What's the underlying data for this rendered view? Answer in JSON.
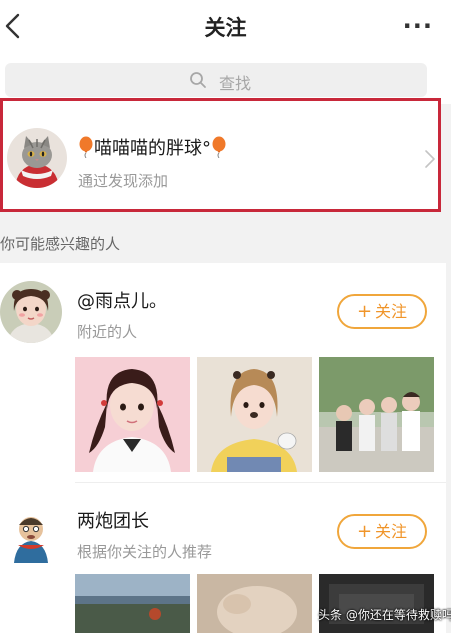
{
  "header": {
    "title": "关注",
    "more_label": "···"
  },
  "search": {
    "placeholder": "查找"
  },
  "highlighted_user": {
    "name": "喵喵喵的胖球°",
    "subtitle": "通过发现添加"
  },
  "section": {
    "label": "你可能感兴趣的人"
  },
  "suggestions": [
    {
      "name": "@雨点儿。",
      "reason": "附近的人",
      "follow_label": "关注"
    },
    {
      "name": "两炮团长",
      "reason": "根据你关注的人推荐",
      "follow_label": "关注"
    }
  ],
  "watermark": {
    "text": "头条 @你还在等待救赎吗"
  },
  "colors": {
    "accent": "#f0952a",
    "highlight_border": "#c8283a"
  }
}
